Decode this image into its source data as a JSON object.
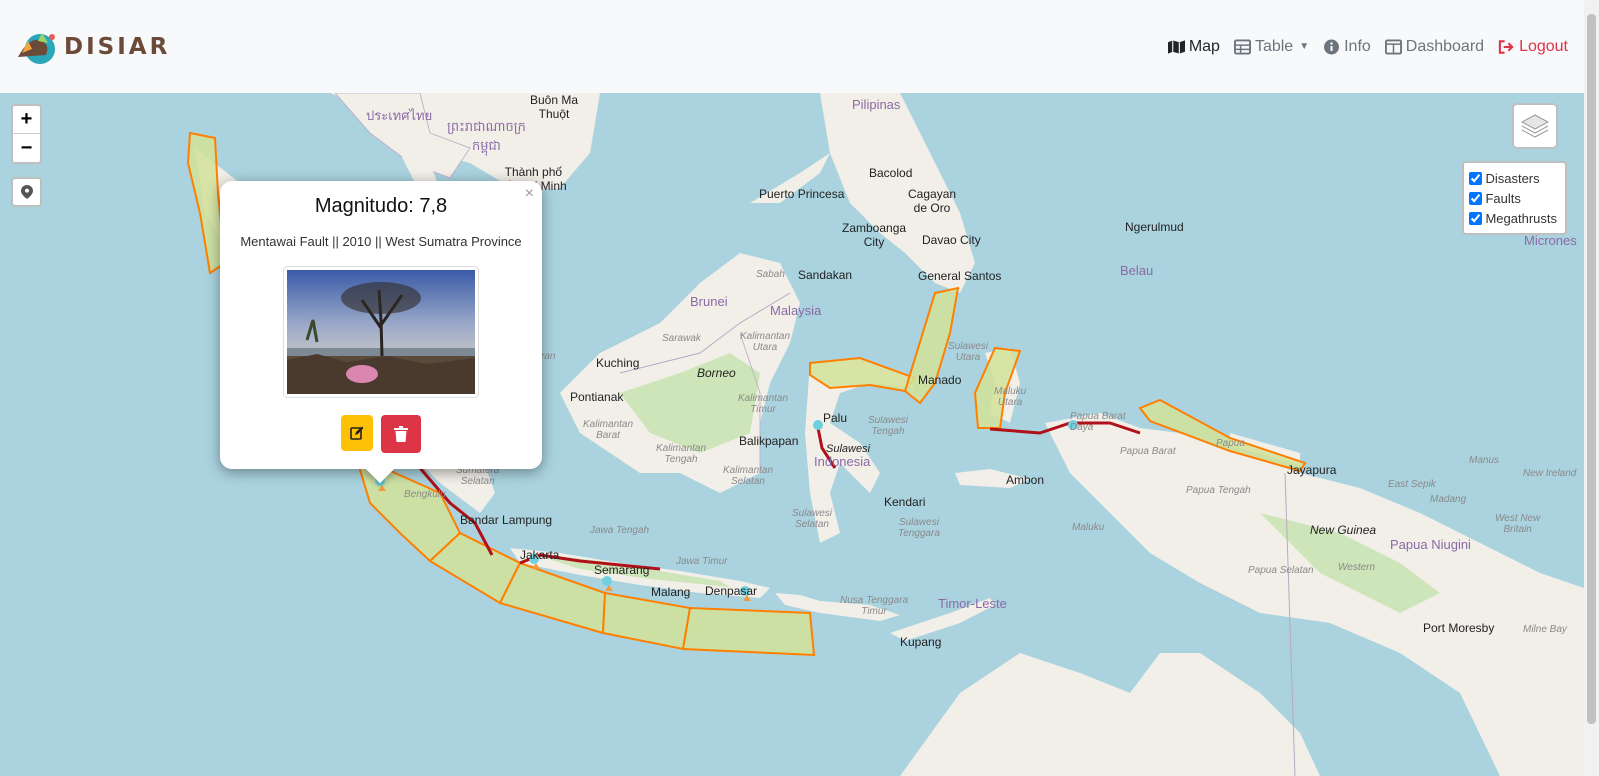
{
  "brand": {
    "name": "DISIAR"
  },
  "nav": {
    "map": "Map",
    "table": "Table",
    "info": "Info",
    "dashboard": "Dashboard",
    "logout": "Logout"
  },
  "map": {
    "zoom_in": "+",
    "zoom_out": "−",
    "layers": [
      {
        "label": "Disasters",
        "checked": true
      },
      {
        "label": "Faults",
        "checked": true
      },
      {
        "label": "Megathrusts",
        "checked": true
      }
    ],
    "labels": {
      "buon_ma_thuot": "Buôn Ma\nThuột",
      "thailand": "ประเทศไทย",
      "cambodia": "ព្រះរាជាណាចក្រ\nកម្ពុជា",
      "hcm": "Thành phố\nHồ Chí Minh",
      "pilipinas": "Pilipinas",
      "bacolod": "Bacolod",
      "puerto_princesa": "Puerto Princesa",
      "cagayan": "Cagayan\nde Oro",
      "zamboanga": "Zamboanga\nCity",
      "davao": "Davao City",
      "ngerulmud": "Ngerulmud",
      "micronesia": "Micrones",
      "belau": "Belau",
      "general_santos": "General Santos",
      "sandakan": "Sandakan",
      "sabah": "Sabah",
      "brunei": "Brunei",
      "malaysia": "Malaysia",
      "sarawak": "Sarawak",
      "kalimantan_utara": "Kalimantan\nUtara",
      "kuching": "Kuching",
      "borneo": "Borneo",
      "manado": "Manado",
      "sulawesi_utara": "Sulawesi\nUtara",
      "maluku_utara": "Maluku\nUtara",
      "pontianak": "Pontianak",
      "kalimantan_timur": "Kalimantan\nTimur",
      "palu": "Palu",
      "sulawesi": "Sulawesi",
      "sulawesi_tengah": "Sulawesi\nTengah",
      "kalimantan_barat": "Kalimantan\nBarat",
      "kalimantan_tengah": "Kalimantan\nTengah",
      "balikpapan": "Balikpapan",
      "indonesia": "Indonesia",
      "papua_barat_daya": "Papua Barat\nDaya",
      "papua_barat": "Papua Barat",
      "papua": "Papua",
      "jayapura": "Jayapura",
      "kalimantan_selatan": "Kalimantan\nSelatan",
      "ambon": "Ambon",
      "papua_tengah": "Papua Tengah",
      "east_sepik": "East Sepik",
      "manus": "Manus",
      "new_ireland": "New Ireland",
      "madang": "Madang",
      "kendari": "Kendari",
      "sulawesi_tenggara": "Sulawesi\nTenggara",
      "sulawesi_selatan": "Sulawesi\nSelatan",
      "maluku": "Maluku",
      "sumatera_selatan": "Sumatera\nSelatan",
      "bengkulu": "Bengkulu",
      "bandar_lampung": "Bandar Lampung",
      "jawa_tengah": "Jawa Tengah",
      "jakarta": "Jakarta",
      "new_guinea": "New Guinea",
      "west_new_britain": "West New\nBritain",
      "papua_niugini": "Papua Niugini",
      "semarang": "Semarang",
      "jawa_timur": "Jawa Timur",
      "malang": "Malang",
      "denpasar": "Denpasar",
      "timor_leste": "Timor-Leste",
      "nusa_tenggara_timur": "Nusa Tenggara\nTimur",
      "papua_selatan": "Papua Selatan",
      "western": "Western",
      "port_moresby": "Port Moresby",
      "milne_bay": "Milne Bay",
      "kupang": "Kupang",
      "fan": "ran"
    }
  },
  "popup": {
    "title": "Magnitudo: 7,8",
    "subtitle": "Mentawai Fault || 2010 || West Sumatra Province",
    "close": "×"
  },
  "colors": {
    "sea": "#aad3df",
    "land": "#f2efe9",
    "forest": "#cde5b8",
    "megathrust_fill": "#d4e29a",
    "megathrust_stroke": "#ff7f00",
    "fault": "#b01018",
    "edit": "#ffc107",
    "delete": "#dc3545",
    "logout": "#dc3545"
  }
}
